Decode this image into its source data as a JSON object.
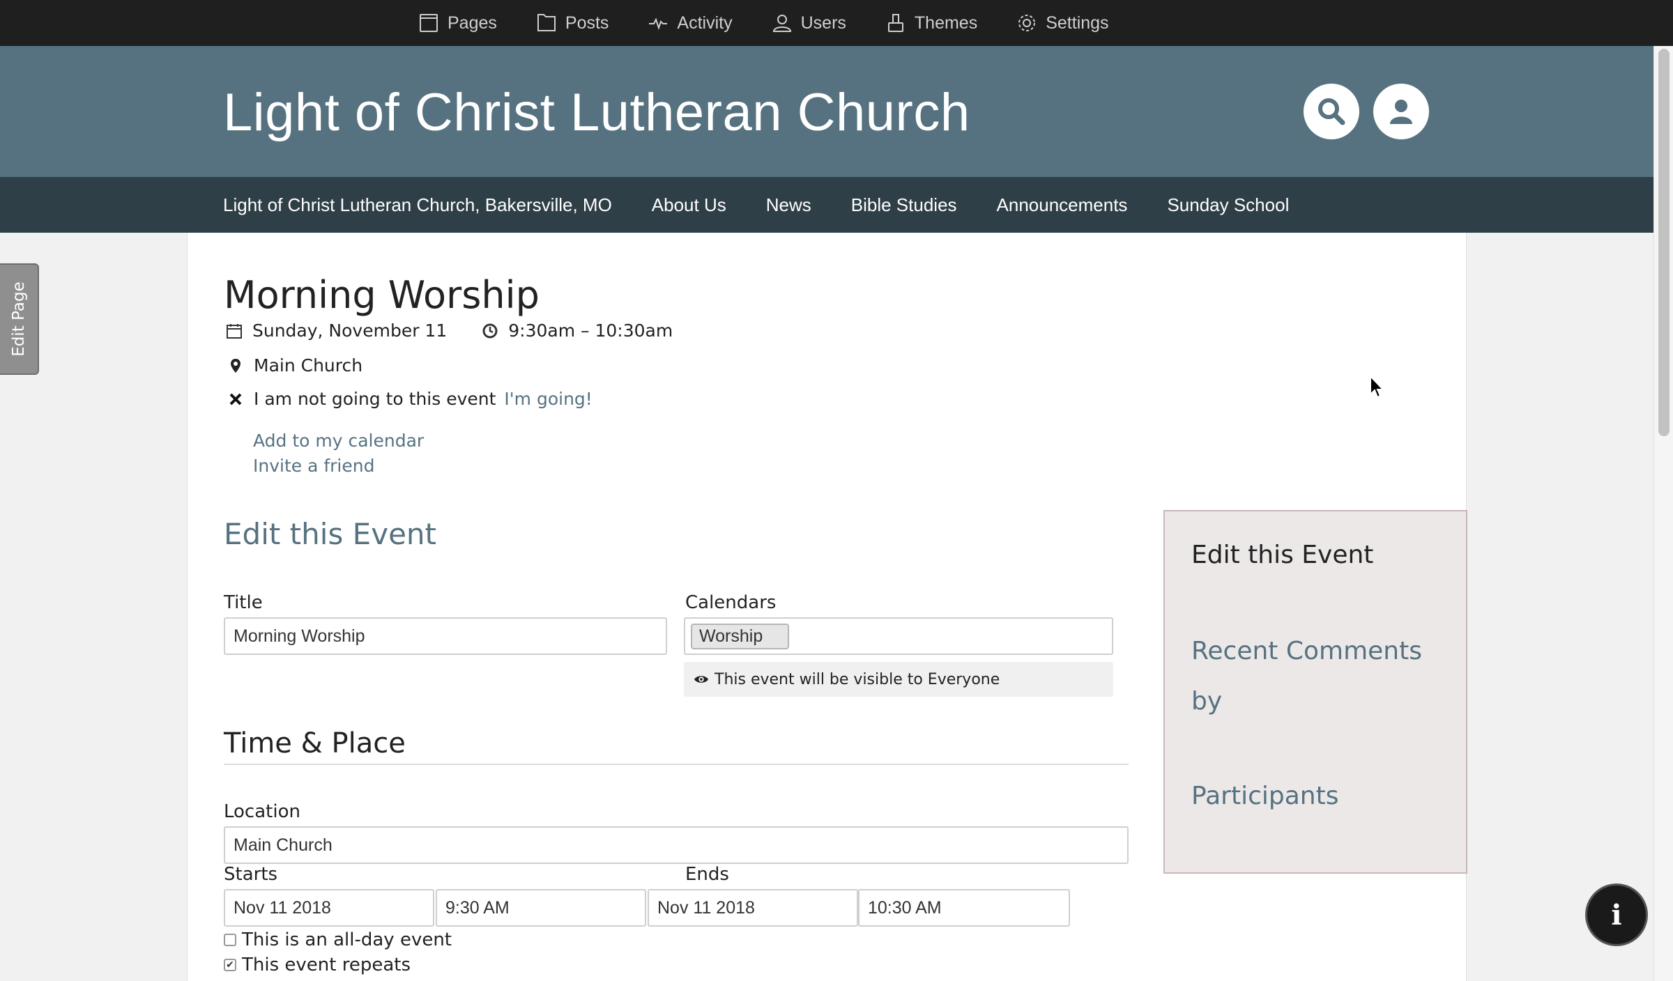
{
  "adminbar": {
    "items": [
      {
        "label": "Pages",
        "icon": "page-icon"
      },
      {
        "label": "Posts",
        "icon": "folder-icon"
      },
      {
        "label": "Activity",
        "icon": "pulse-icon"
      },
      {
        "label": "Users",
        "icon": "user-icon"
      },
      {
        "label": "Themes",
        "icon": "paint-brush-icon"
      },
      {
        "label": "Settings",
        "icon": "gear-icon"
      }
    ]
  },
  "header": {
    "site_title": "Light of Christ Lutheran Church"
  },
  "nav": {
    "links": [
      "Light of Christ Lutheran Church, Bakersville, MO",
      "About Us",
      "News",
      "Bible Studies",
      "Announcements",
      "Sunday School"
    ]
  },
  "edit_tab": {
    "label": "Edit Page"
  },
  "event": {
    "title": "Morning Worship",
    "date": "Sunday, November 11",
    "time": "9:30am – 10:30am",
    "location": "Main Church",
    "rsvp_status": "I am not going to this event",
    "rsvp_action": "I'm going!",
    "add_calendar": "Add to my calendar",
    "invite": "Invite a friend"
  },
  "form": {
    "heading": "Edit this Event",
    "title_label": "Title",
    "title_value": "Morning Worship",
    "calendars_label": "Calendars",
    "calendar_tag": "Worship",
    "visibility_text": "This event will be visible to Everyone",
    "time_place_heading": "Time & Place",
    "location_label": "Location",
    "location_value": "Main Church",
    "starts_label": "Starts",
    "ends_label": "Ends",
    "start_date": "Nov 11 2018",
    "start_time": "9:30 AM",
    "end_date": "Nov 11 2018",
    "end_time": "10:30 AM",
    "allday_label": "This is an all-day event",
    "repeats_label": "This event repeats",
    "repeats_checked": true
  },
  "sidebar": {
    "edit_heading": "Edit this Event",
    "comments_heading": "Recent Comments",
    "by_text": "by",
    "participants_heading": "Participants"
  },
  "colors": {
    "header_bg": "#567280",
    "nav_bg": "#2f3f47",
    "accent": "#567280",
    "sidebar_bg": "#ece8e8"
  }
}
